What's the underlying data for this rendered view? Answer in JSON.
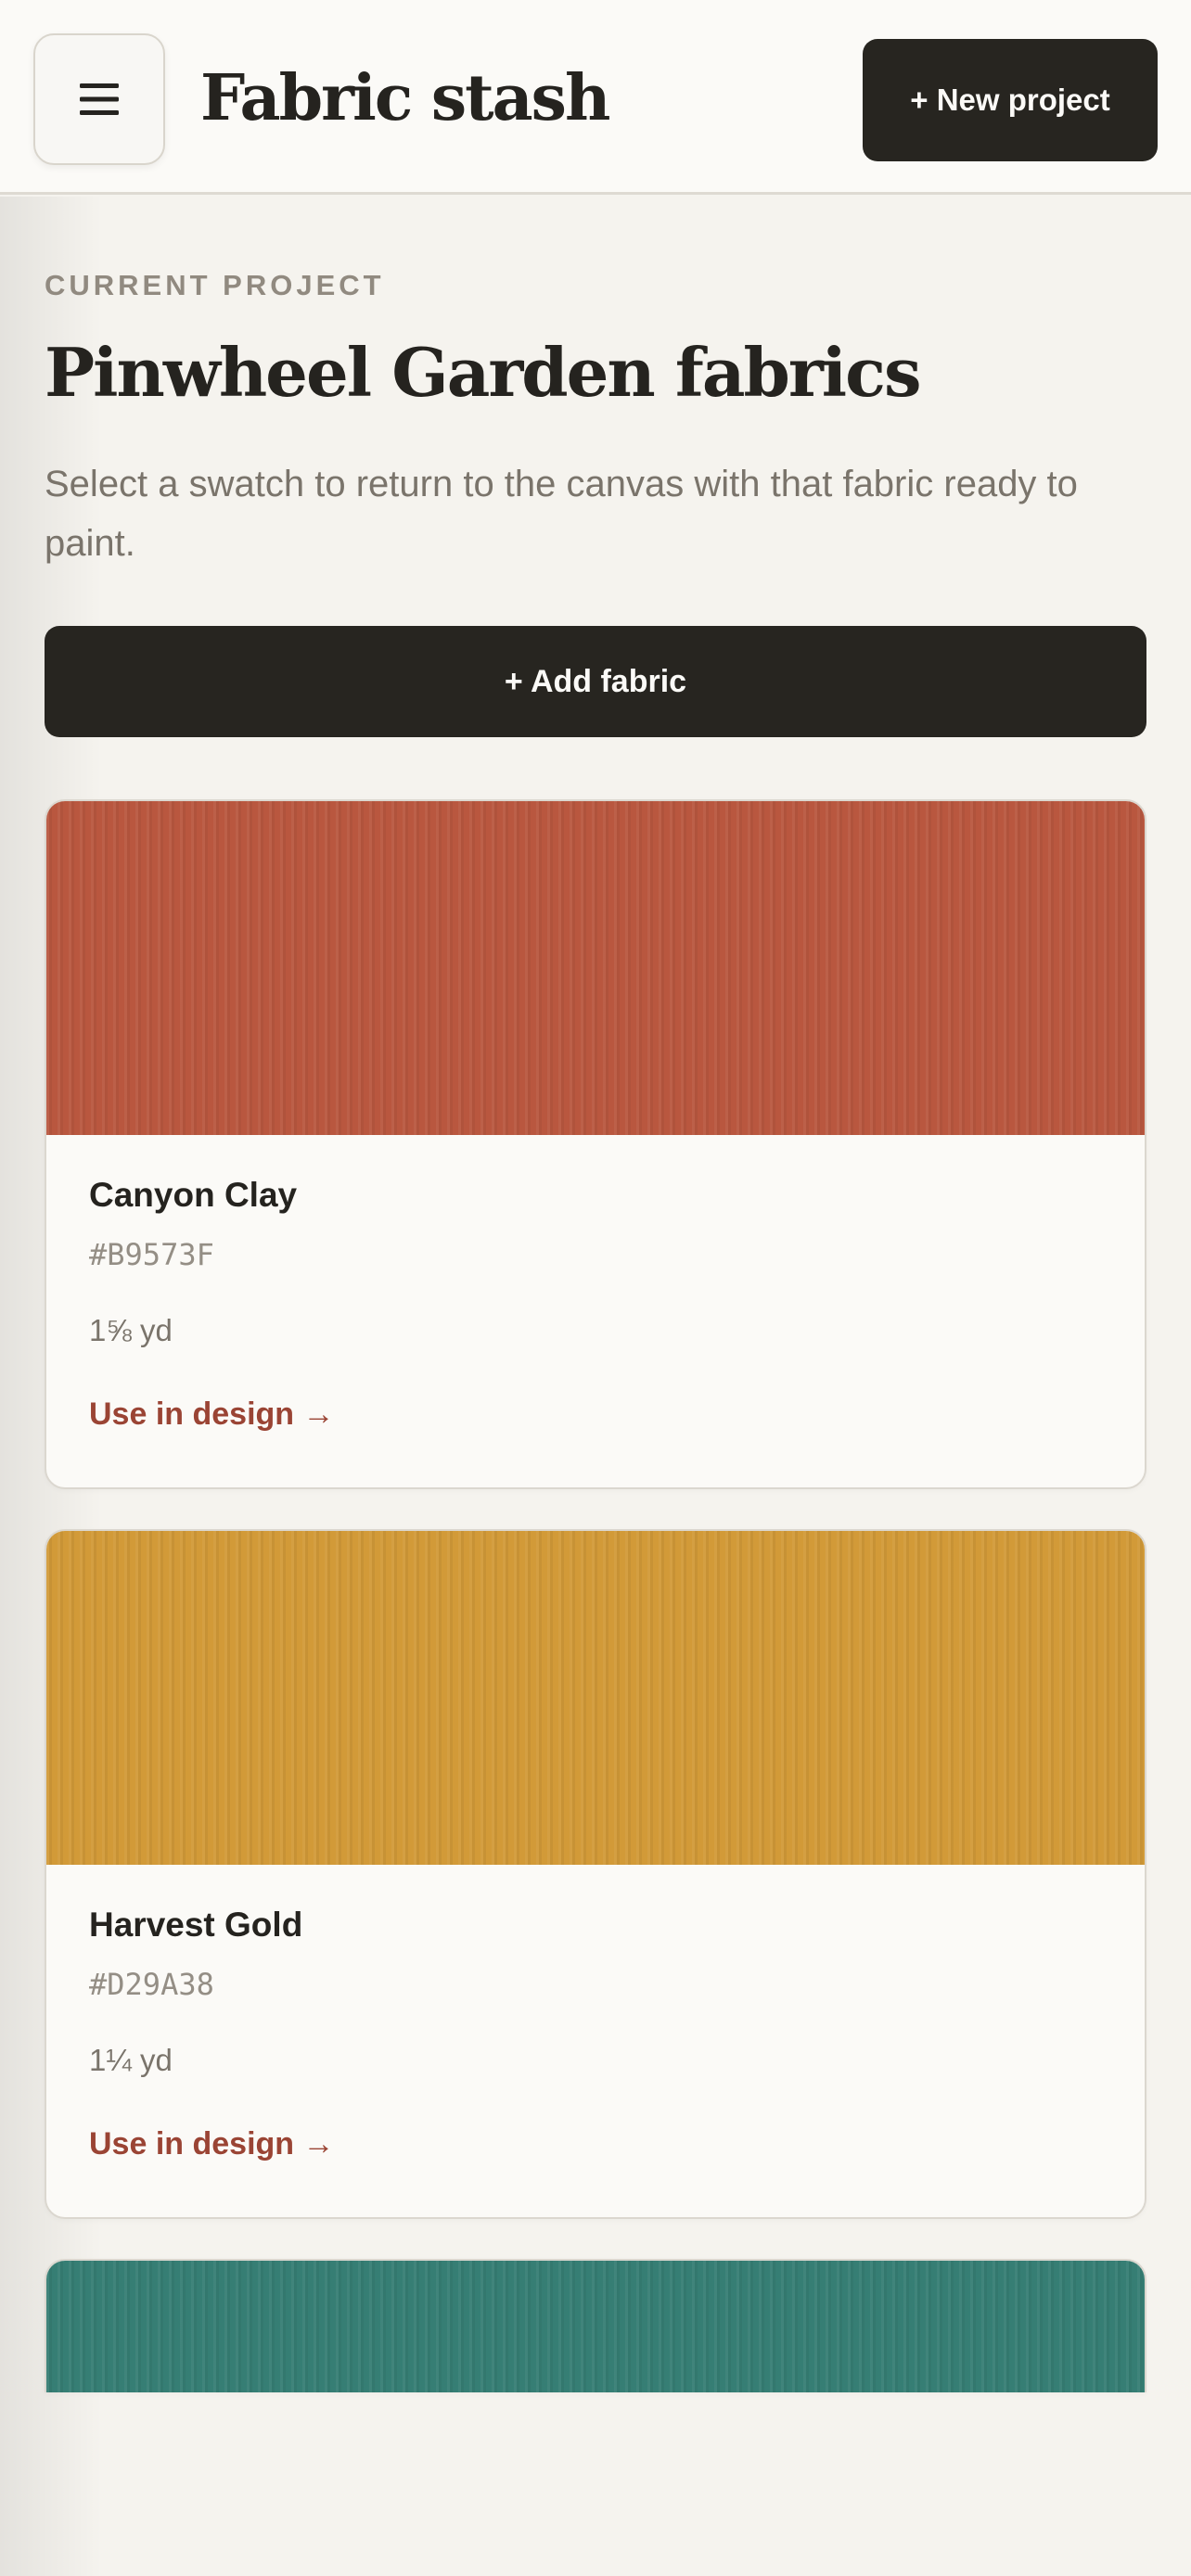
{
  "header": {
    "menu_icon": "hamburger-menu-icon",
    "app_title": "Fabric stash",
    "new_project_label": "+ New project"
  },
  "project": {
    "eyebrow": "CURRENT PROJECT",
    "title": "Pinwheel Garden fabrics",
    "subtitle": "Select a swatch to return to the canvas with that fabric ready to paint.",
    "add_fabric_label": "+ Add fabric"
  },
  "fabrics": [
    {
      "name": "Canyon Clay",
      "hex": "#B9573F",
      "quantity": "1⅝ yd",
      "action_label": "Use in design →",
      "color": "#B9573F"
    },
    {
      "name": "Harvest Gold",
      "hex": "#D29A38",
      "quantity": "1¼ yd",
      "action_label": "Use in design →",
      "color": "#D29A38"
    },
    {
      "color": "#367E74"
    }
  ],
  "colors": {
    "accent_link": "#9a4434",
    "dark_button": "#272520",
    "background": "#f5f3ee"
  }
}
